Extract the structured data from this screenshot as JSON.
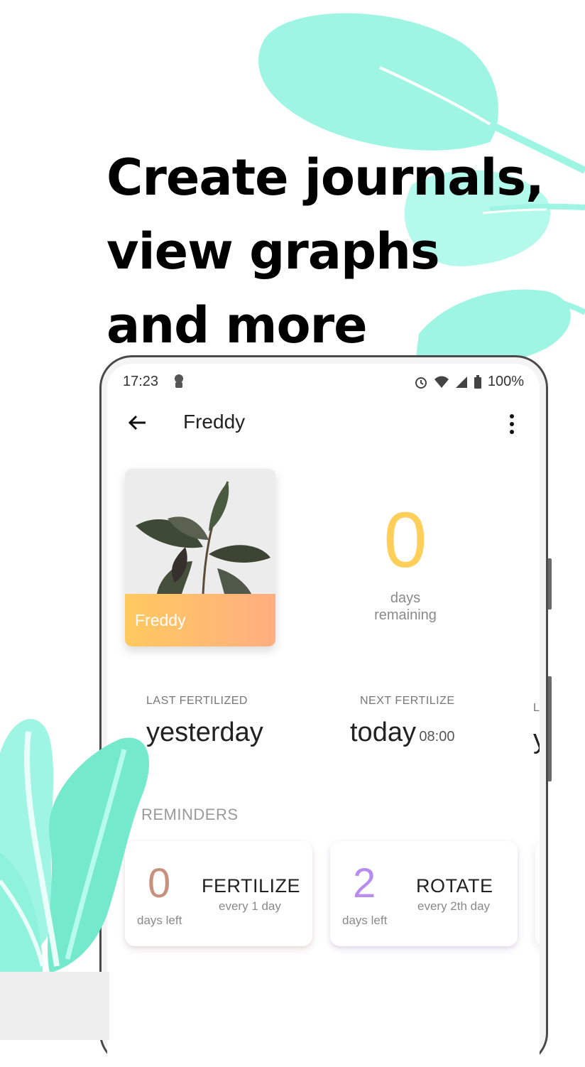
{
  "headline": {
    "line1": "Create journals,",
    "line2": "view graphs",
    "line3": "and more"
  },
  "status_bar": {
    "time": "17:23",
    "battery": "100%"
  },
  "app_bar": {
    "title": "Freddy"
  },
  "plant_card": {
    "name": "Freddy"
  },
  "countdown": {
    "value": "0",
    "label_line1": "days",
    "label_line2": "remaining"
  },
  "stats": [
    {
      "label": "LAST FERTILIZED",
      "value": "yesterday",
      "time": ""
    },
    {
      "label": "NEXT FERTILIZE",
      "value": "today",
      "time": "08:00"
    },
    {
      "label": "L",
      "value": "y",
      "time": ""
    }
  ],
  "reminders": {
    "heading": "REMINDERS",
    "items": [
      {
        "count": "0",
        "count_label": "days left",
        "title": "FERTILIZE",
        "frequency": "every 1 day",
        "color": "#c8917e"
      },
      {
        "count": "2",
        "count_label": "days left",
        "title": "ROTATE",
        "frequency": "every 2th day",
        "color": "#b98cf0"
      }
    ]
  },
  "colors": {
    "leaf": "#9ff5e4",
    "leaf_dark": "#74e9cc",
    "accent_yellow": "#ffcf5a"
  },
  "icons": [
    "back-arrow-icon",
    "more-vert-icon",
    "plant-status-icon",
    "alarm-icon",
    "wifi-icon",
    "signal-icon",
    "battery-icon"
  ]
}
